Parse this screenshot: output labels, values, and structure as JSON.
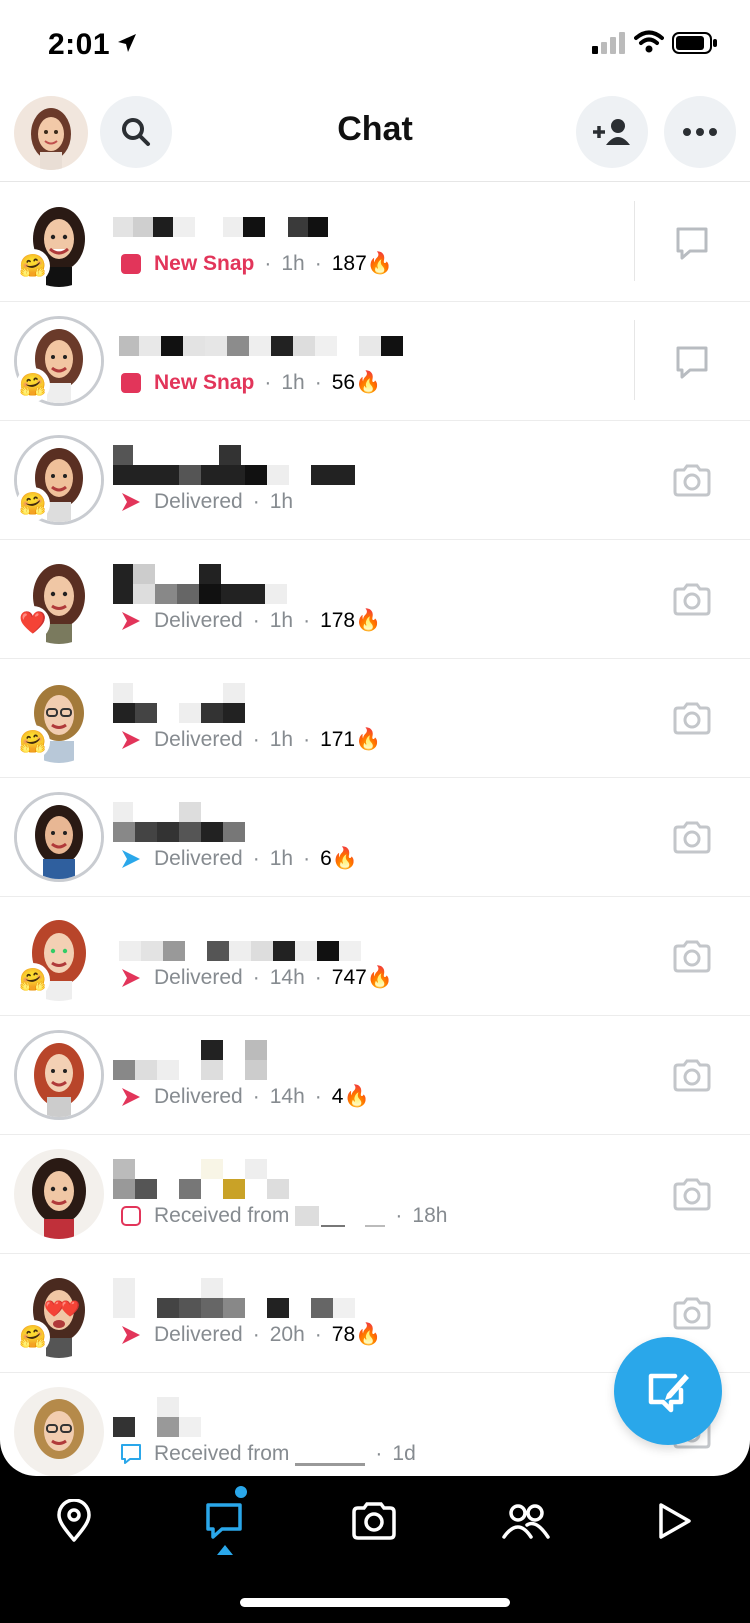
{
  "status_bar": {
    "time": "2:01"
  },
  "header": {
    "title": "Chat"
  },
  "icons": {
    "search": "search-icon",
    "add_friend": "add-friend-icon",
    "more": "more-icon",
    "chat": "chat-icon",
    "camera": "camera-icon"
  },
  "chats": [
    {
      "status": "New Snap",
      "time": "1h",
      "streak": "187",
      "type": "new"
    },
    {
      "status": "New Snap",
      "time": "1h",
      "streak": "56",
      "type": "new"
    },
    {
      "status": "Delivered",
      "time": "1h",
      "streak": "",
      "type": "delivered"
    },
    {
      "status": "Delivered",
      "time": "1h",
      "streak": "178",
      "type": "delivered"
    },
    {
      "status": "Delivered",
      "time": "1h",
      "streak": "171",
      "type": "delivered"
    },
    {
      "status": "Delivered",
      "time": "1h",
      "streak": "6",
      "type": "delivered-blue"
    },
    {
      "status": "Delivered",
      "time": "14h",
      "streak": "747",
      "type": "delivered"
    },
    {
      "status": "Delivered",
      "time": "14h",
      "streak": "4",
      "type": "delivered"
    },
    {
      "status": "Received from",
      "time": "18h",
      "streak": "",
      "type": "received"
    },
    {
      "status": "Delivered",
      "time": "20h",
      "streak": "78",
      "type": "delivered"
    },
    {
      "status": "Received from",
      "time": "1d",
      "streak": "",
      "type": "received-chat"
    }
  ],
  "colors": {
    "new_snap": "#e2355a",
    "chat_blue": "#2aa7ea",
    "meta": "#868b90"
  }
}
